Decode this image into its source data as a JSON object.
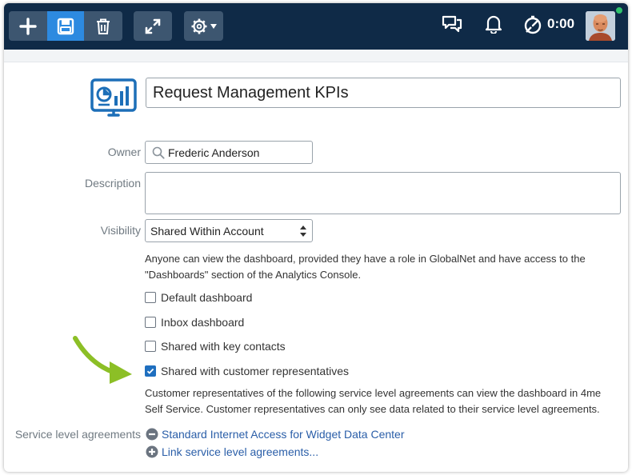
{
  "toolbar": {
    "buttons": [
      {
        "name": "add",
        "icon": "plus-icon"
      },
      {
        "name": "save",
        "icon": "save-icon"
      },
      {
        "name": "delete",
        "icon": "trash-icon"
      },
      {
        "name": "expand",
        "icon": "expand-icon"
      },
      {
        "name": "settings",
        "icon": "gear-icon"
      }
    ],
    "timer": "0:00"
  },
  "form": {
    "title_value": "Request Management KPIs",
    "owner_label": "Owner",
    "owner_value": "Frederic Anderson",
    "description_label": "Description",
    "description_value": "",
    "visibility_label": "Visibility",
    "visibility_value": "Shared Within Account",
    "visibility_help": "Anyone can view the dashboard, provided they have a role in GlobalNet and have access to the \"Dashboards\" section of the Analytics Console.",
    "checkboxes": [
      {
        "label": "Default dashboard",
        "checked": false
      },
      {
        "label": "Inbox dashboard",
        "checked": false
      },
      {
        "label": "Shared with key contacts",
        "checked": false
      },
      {
        "label": "Shared with customer representatives",
        "checked": true
      }
    ],
    "customer_rep_help": "Customer representatives of the following service level agreements can view the dashboard in 4me Self Service. Customer representatives can only see data related to their service level agreements.",
    "sla_label": "Service level agreements",
    "sla_items": [
      "Standard Internet Access for Widget Data Center"
    ],
    "sla_link": "Link service level agreements..."
  },
  "colors": {
    "topbar": "#0f2a47",
    "active_button": "#2d8ae0",
    "link": "#2a5ea8",
    "arrow": "#8cbf26",
    "checkbox_checked": "#1f6fbf"
  }
}
